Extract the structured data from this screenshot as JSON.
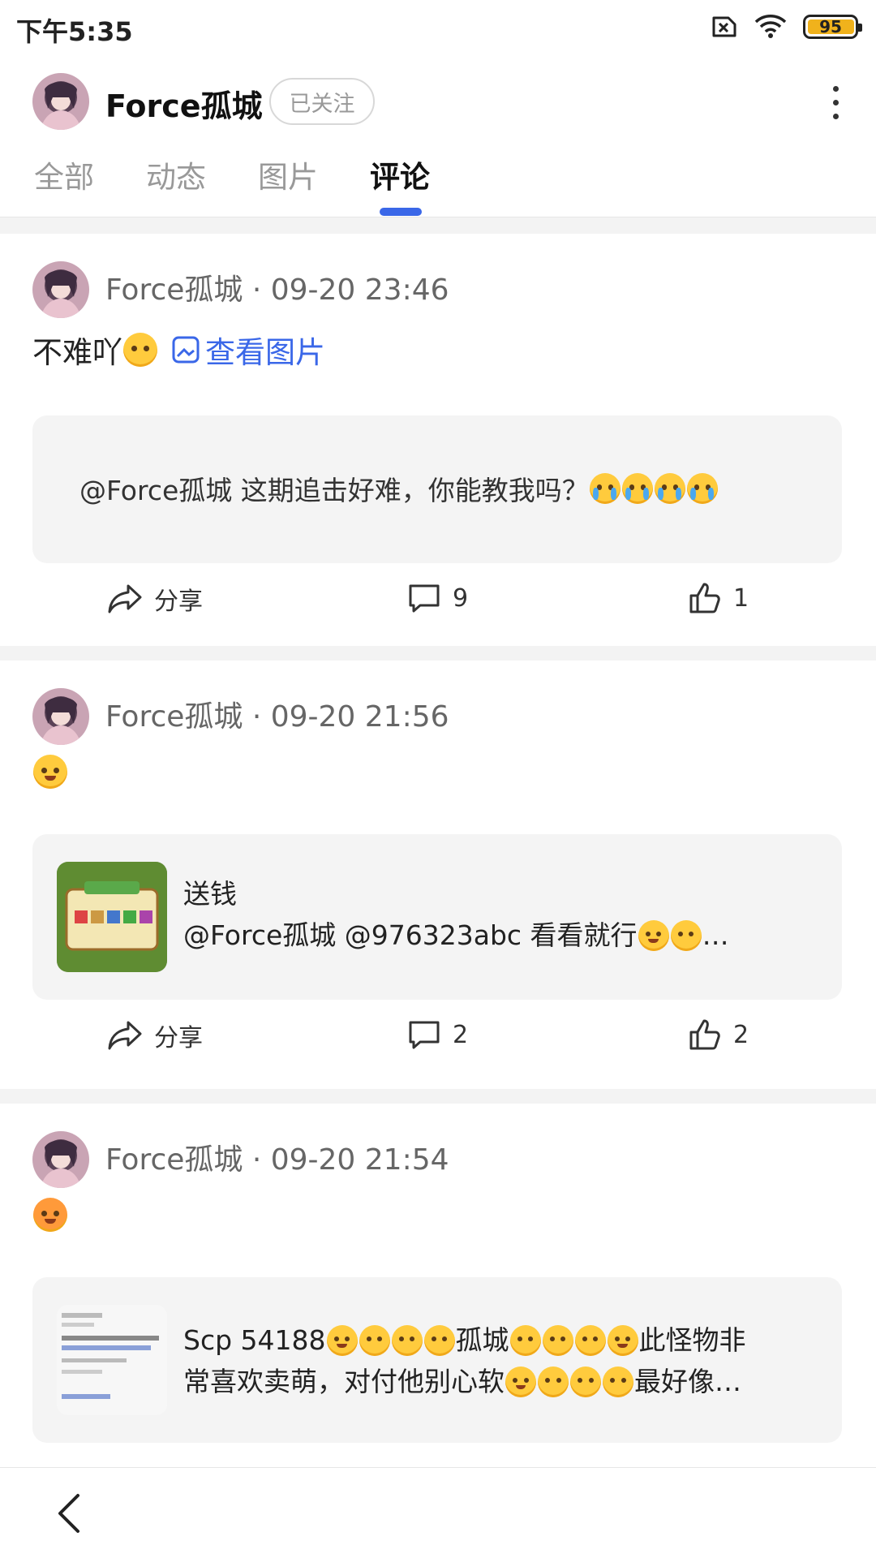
{
  "status_bar": {
    "time": "下午5:35",
    "battery": "95",
    "battery_level": 0.95,
    "icons": [
      "sim-off-icon",
      "wifi-icon",
      "battery-icon"
    ]
  },
  "header": {
    "username": "Force孤城",
    "follow_label": "已关注",
    "more_icon": "more-vertical-icon"
  },
  "tabs": [
    {
      "label": "全部",
      "active": false
    },
    {
      "label": "动态",
      "active": false
    },
    {
      "label": "图片",
      "active": false
    },
    {
      "label": "评论",
      "active": true
    }
  ],
  "accent_color": "#3a67e8",
  "posts": [
    {
      "meta": "Force孤城 · 09-20 23:46",
      "text": "不难吖",
      "view_image_label": "查看图片",
      "quote": "@Force孤城 这期追击好难，你能教我吗？",
      "share_label": "分享",
      "comments": "9",
      "likes": "1"
    },
    {
      "meta": "Force孤城 · 09-20 21:56",
      "text": "",
      "quote_title": "送钱",
      "quote": "@Force孤城 @976323abc 看看就行",
      "quote_suffix": "…",
      "share_label": "分享",
      "comments": "2",
      "likes": "2"
    },
    {
      "meta": "Force孤城 · 09-20 21:54",
      "text": "",
      "quote_line1_a": "Scp 54188",
      "quote_line1_b": "孤城",
      "quote_line1_c": "此怪物非",
      "quote_line2_a": "常喜欢卖萌，对付他别心软",
      "quote_line2_b": "最好像…"
    }
  ],
  "bottom_bar": {
    "back_icon": "back-chevron-icon"
  }
}
